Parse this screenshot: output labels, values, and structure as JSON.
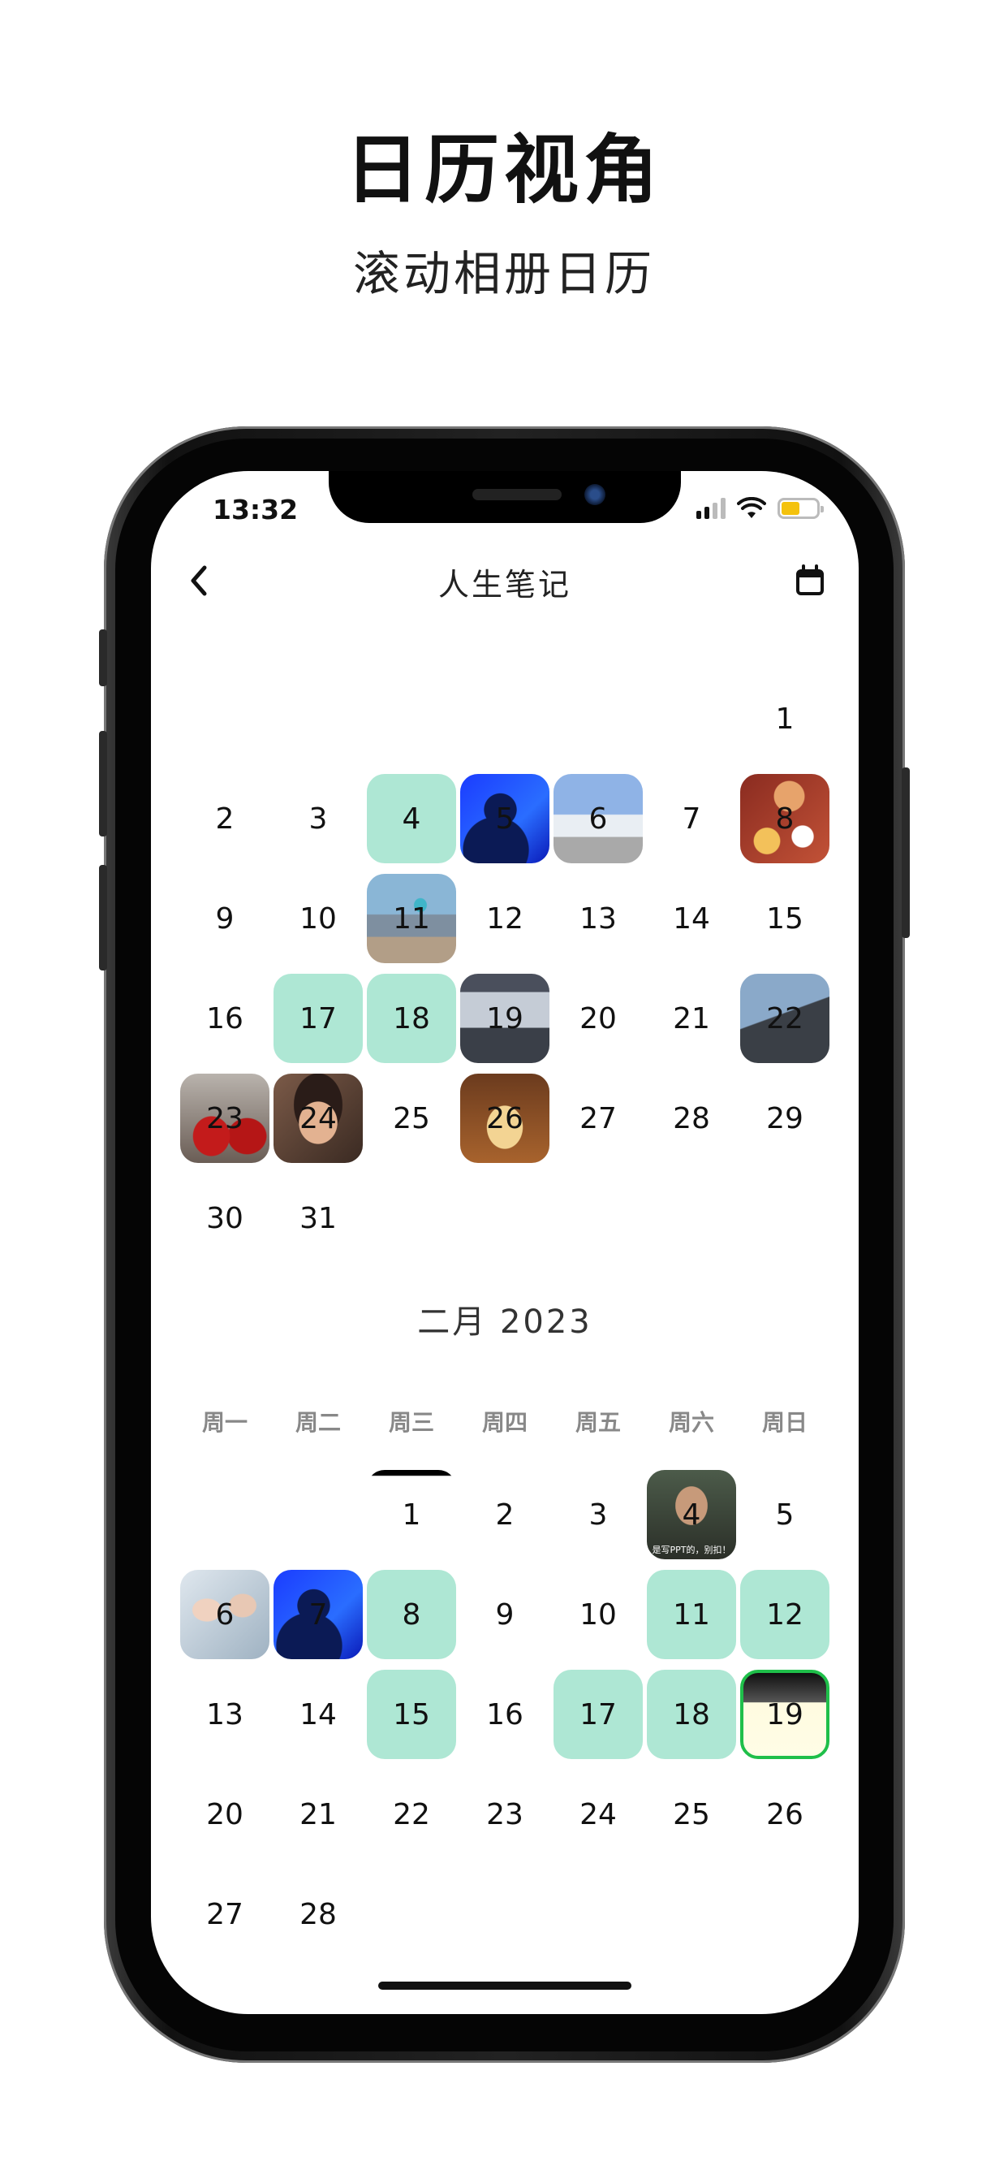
{
  "promo": {
    "title": "日历视角",
    "subtitle": "滚动相册日历"
  },
  "status_bar": {
    "time": "13:32"
  },
  "nav": {
    "title": "人生笔记",
    "back_icon": "chevron-left-icon",
    "calendar_icon": "calendar-icon"
  },
  "month1": {
    "days": [
      {
        "d": "1",
        "col": 6,
        "row": 0,
        "style": "plain"
      },
      {
        "d": "2",
        "col": 0,
        "row": 1,
        "style": "plain"
      },
      {
        "d": "3",
        "col": 1,
        "row": 1,
        "style": "plain"
      },
      {
        "d": "4",
        "col": 2,
        "row": 1,
        "style": "mint"
      },
      {
        "d": "5",
        "col": 3,
        "row": 1,
        "style": "photo",
        "photo": "blue-silhouette"
      },
      {
        "d": "6",
        "col": 4,
        "row": 1,
        "style": "photo",
        "photo": "building-sky"
      },
      {
        "d": "7",
        "col": 5,
        "row": 1,
        "style": "plain"
      },
      {
        "d": "8",
        "col": 6,
        "row": 1,
        "style": "photo",
        "photo": "food-table"
      },
      {
        "d": "9",
        "col": 0,
        "row": 2,
        "style": "plain"
      },
      {
        "d": "10",
        "col": 1,
        "row": 2,
        "style": "plain"
      },
      {
        "d": "11",
        "col": 2,
        "row": 2,
        "style": "photo",
        "photo": "beach-jump"
      },
      {
        "d": "12",
        "col": 3,
        "row": 2,
        "style": "plain"
      },
      {
        "d": "13",
        "col": 4,
        "row": 2,
        "style": "plain"
      },
      {
        "d": "14",
        "col": 5,
        "row": 2,
        "style": "plain"
      },
      {
        "d": "15",
        "col": 6,
        "row": 2,
        "style": "plain"
      },
      {
        "d": "16",
        "col": 0,
        "row": 3,
        "style": "plain"
      },
      {
        "d": "17",
        "col": 1,
        "row": 3,
        "style": "mint"
      },
      {
        "d": "18",
        "col": 2,
        "row": 3,
        "style": "mint"
      },
      {
        "d": "19",
        "col": 3,
        "row": 3,
        "style": "photo",
        "photo": "car-plate"
      },
      {
        "d": "20",
        "col": 4,
        "row": 3,
        "style": "plain"
      },
      {
        "d": "21",
        "col": 5,
        "row": 3,
        "style": "plain"
      },
      {
        "d": "22",
        "col": 6,
        "row": 3,
        "style": "photo",
        "photo": "stadium"
      },
      {
        "d": "23",
        "col": 0,
        "row": 4,
        "style": "photo",
        "photo": "street-red"
      },
      {
        "d": "24",
        "col": 1,
        "row": 4,
        "style": "photo",
        "photo": "selfie"
      },
      {
        "d": "25",
        "col": 2,
        "row": 4,
        "style": "plain"
      },
      {
        "d": "26",
        "col": 3,
        "row": 4,
        "style": "photo",
        "photo": "dessert"
      },
      {
        "d": "27",
        "col": 4,
        "row": 4,
        "style": "plain"
      },
      {
        "d": "28",
        "col": 5,
        "row": 4,
        "style": "plain"
      },
      {
        "d": "29",
        "col": 6,
        "row": 4,
        "style": "plain"
      },
      {
        "d": "30",
        "col": 0,
        "row": 5,
        "style": "plain"
      },
      {
        "d": "31",
        "col": 1,
        "row": 5,
        "style": "plain"
      }
    ]
  },
  "month2": {
    "title": "二月 2023",
    "weekdays": [
      "周一",
      "周二",
      "周三",
      "周四",
      "周五",
      "周六",
      "周日"
    ],
    "days": [
      {
        "d": "1",
        "col": 2,
        "row": 0,
        "style": "photo",
        "photo": "document"
      },
      {
        "d": "2",
        "col": 3,
        "row": 0,
        "style": "plain"
      },
      {
        "d": "3",
        "col": 4,
        "row": 0,
        "style": "plain"
      },
      {
        "d": "4",
        "col": 5,
        "row": 0,
        "style": "photo",
        "photo": "meme",
        "caption": "是写PPT的，别扣！"
      },
      {
        "d": "5",
        "col": 6,
        "row": 0,
        "style": "plain"
      },
      {
        "d": "6",
        "col": 0,
        "row": 1,
        "style": "photo",
        "photo": "drama"
      },
      {
        "d": "7",
        "col": 1,
        "row": 1,
        "style": "photo",
        "photo": "blue-silhouette"
      },
      {
        "d": "8",
        "col": 2,
        "row": 1,
        "style": "mint"
      },
      {
        "d": "9",
        "col": 3,
        "row": 1,
        "style": "plain"
      },
      {
        "d": "10",
        "col": 4,
        "row": 1,
        "style": "plain"
      },
      {
        "d": "11",
        "col": 5,
        "row": 1,
        "style": "mint"
      },
      {
        "d": "12",
        "col": 6,
        "row": 1,
        "style": "mint"
      },
      {
        "d": "13",
        "col": 0,
        "row": 2,
        "style": "plain"
      },
      {
        "d": "14",
        "col": 1,
        "row": 2,
        "style": "plain"
      },
      {
        "d": "15",
        "col": 2,
        "row": 2,
        "style": "mint"
      },
      {
        "d": "16",
        "col": 3,
        "row": 2,
        "style": "plain"
      },
      {
        "d": "17",
        "col": 4,
        "row": 2,
        "style": "mint"
      },
      {
        "d": "18",
        "col": 5,
        "row": 2,
        "style": "mint"
      },
      {
        "d": "19",
        "col": 6,
        "row": 2,
        "style": "today"
      },
      {
        "d": "20",
        "col": 0,
        "row": 3,
        "style": "plain"
      },
      {
        "d": "21",
        "col": 1,
        "row": 3,
        "style": "plain"
      },
      {
        "d": "22",
        "col": 2,
        "row": 3,
        "style": "plain"
      },
      {
        "d": "23",
        "col": 3,
        "row": 3,
        "style": "plain"
      },
      {
        "d": "24",
        "col": 4,
        "row": 3,
        "style": "plain"
      },
      {
        "d": "25",
        "col": 5,
        "row": 3,
        "style": "plain"
      },
      {
        "d": "26",
        "col": 6,
        "row": 3,
        "style": "plain"
      },
      {
        "d": "27",
        "col": 0,
        "row": 4,
        "style": "plain"
      },
      {
        "d": "28",
        "col": 1,
        "row": 4,
        "style": "plain"
      }
    ]
  }
}
